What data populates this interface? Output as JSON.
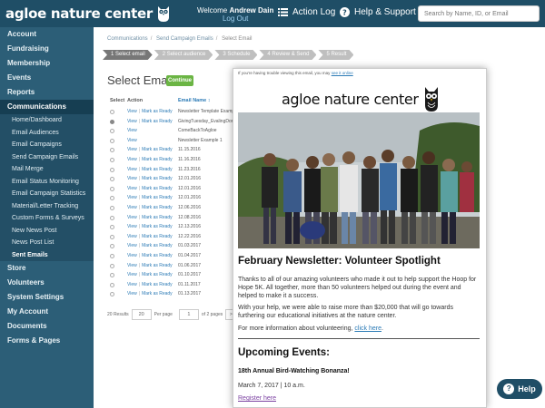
{
  "header": {
    "brand": "agloe nature center",
    "welcome_prefix": "Welcome",
    "user_name": "Andrew Dain",
    "logout": "Log Out",
    "action_log": "Action Log",
    "help_support": "Help & Support",
    "search_placeholder": "Search by Name, ID, or Email"
  },
  "sidebar": {
    "items_top": [
      "Account",
      "Fundraising",
      "Membership",
      "Events",
      "Reports"
    ],
    "active": "Communications",
    "sub_items": [
      "Home/Dashboard",
      "Email Audiences",
      "Email Campaigns",
      "Send Campaign Emails",
      "Mail Merge",
      "Email Status Monitoring",
      "Email Campaign Statistics",
      "Material/Letter Tracking",
      "Custom Forms & Surveys",
      "New News Post",
      "News Post List",
      "Sent Emails"
    ],
    "items_bottom": [
      "Store",
      "Volunteers",
      "System Settings",
      "My Account",
      "Documents",
      "Forms & Pages"
    ]
  },
  "main": {
    "breadcrumb": [
      "Communications",
      "Send Campaign Emails",
      "Select Email"
    ],
    "steps": [
      "1 Select email",
      "2 Select audience",
      "3 Schedule",
      "4 Review & Send",
      "5 Result"
    ],
    "title": "Select Email",
    "continue": "Continue",
    "columns": {
      "select": "Select",
      "action": "Action",
      "name": "Email Name ↕"
    },
    "rows": [
      {
        "action": [
          "View",
          "Mark as Ready"
        ],
        "name": "Newsletter Template Example",
        "selected": false
      },
      {
        "action": [
          "View",
          "Mark as Ready"
        ],
        "name": "GivingTuesday_EvalingDonors",
        "selected": true
      },
      {
        "action": [
          "View"
        ],
        "name": "ComeBackToAgloe",
        "selected": false
      },
      {
        "action": [
          "View"
        ],
        "name": "Newsletter Example 1",
        "selected": false
      },
      {
        "action": [
          "View",
          "Mark as Ready"
        ],
        "name": "11.15.2016",
        "selected": false
      },
      {
        "action": [
          "View",
          "Mark as Ready"
        ],
        "name": "11.16.2016",
        "selected": false
      },
      {
        "action": [
          "View",
          "Mark as Ready"
        ],
        "name": "11.23.2016",
        "selected": false
      },
      {
        "action": [
          "View",
          "Mark as Ready"
        ],
        "name": "12.01.2016",
        "selected": false
      },
      {
        "action": [
          "View",
          "Mark as Ready"
        ],
        "name": "12.01.2016",
        "selected": false
      },
      {
        "action": [
          "View",
          "Mark as Ready"
        ],
        "name": "12.01.2016",
        "selected": false
      },
      {
        "action": [
          "View",
          "Mark as Ready"
        ],
        "name": "12.06.2016",
        "selected": false
      },
      {
        "action": [
          "View",
          "Mark as Ready"
        ],
        "name": "12.08.2016",
        "selected": false
      },
      {
        "action": [
          "View",
          "Mark as Ready"
        ],
        "name": "12.13.2016",
        "selected": false
      },
      {
        "action": [
          "View",
          "Mark as Ready"
        ],
        "name": "12.22.2016",
        "selected": false
      },
      {
        "action": [
          "View",
          "Mark as Ready"
        ],
        "name": "01.03.2017",
        "selected": false
      },
      {
        "action": [
          "View",
          "Mark as Ready"
        ],
        "name": "01.04.2017",
        "selected": false
      },
      {
        "action": [
          "View",
          "Mark as Ready"
        ],
        "name": "01.06.2017",
        "selected": false
      },
      {
        "action": [
          "View",
          "Mark as Ready"
        ],
        "name": "01.10.2017",
        "selected": false
      },
      {
        "action": [
          "View",
          "Mark as Ready"
        ],
        "name": "01.11.2017",
        "selected": false
      },
      {
        "action": [
          "View",
          "Mark as Ready"
        ],
        "name": "01.13.2017",
        "selected": false
      }
    ],
    "pager": {
      "results": "20 Results",
      "per_page_value": "20",
      "per_page_label": "Per page",
      "page_value": "1",
      "of_pages": "of 2 pages",
      "next": ">"
    }
  },
  "preview": {
    "note": "If you're having trouble viewing this email, you may",
    "note_link": "see it online",
    "logo_text": "agloe nature center",
    "heading": "February Newsletter: Volunteer Spotlight",
    "para1": "Thanks to all of our amazing volunteers who made it out to help support the Hoop for Hope 5K. All together, more than 50 volunteers helped out during the event and helped to make it a success.",
    "para2": "With your help, we were able to raise more than $20,000 that will go towards furthering our educational initiatives at the nature center.",
    "para3_prefix": "For more information about volunteering,",
    "para3_link": "click here",
    "upcoming_heading": "Upcoming Events:",
    "event_title": "18th Annual Bird-Watching Bonanza!",
    "event_date": "March 7, 2017 | 10 a.m.",
    "register": "Register here"
  },
  "help_button": "Help",
  "colors": {
    "topbar": "#1f4e66",
    "sidebar": "#2c5e77",
    "active_nav": "#163e52",
    "continue": "#6bb544",
    "link": "#2c7bb6"
  }
}
